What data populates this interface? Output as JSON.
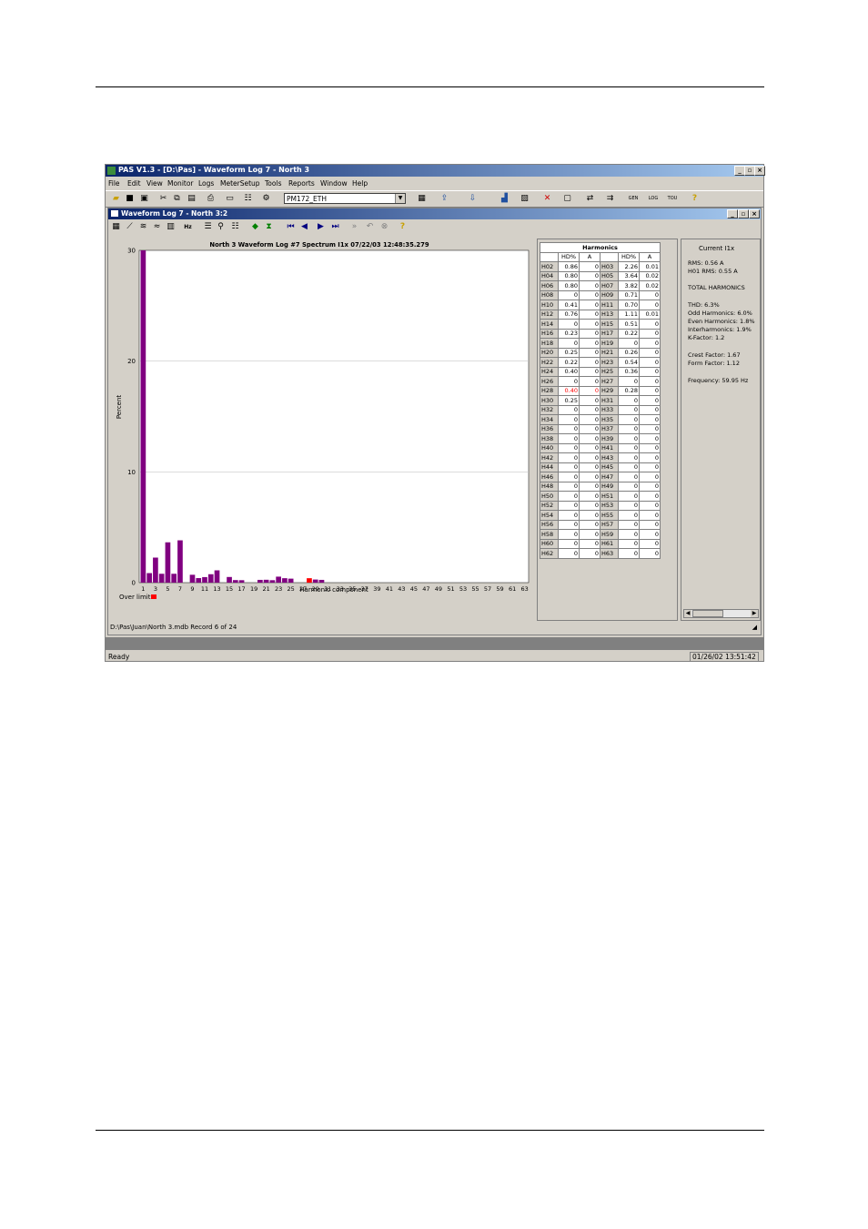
{
  "app": {
    "title": "PAS V1.3 - [D:\\Pas] - Waveform Log 7 - North 3",
    "menu": [
      "File",
      "Edit",
      "View",
      "Monitor",
      "Logs",
      "MeterSetup",
      "Tools",
      "Reports",
      "Window",
      "Help"
    ],
    "device_combo": "PM172_ETH",
    "status_left": "Ready",
    "status_right": "01/26/02 13:51:42",
    "toolbar_icons": [
      "open-icon",
      "save-icon",
      "save-all-icon",
      "cut-icon",
      "copy-icon",
      "paste-icon",
      "print-icon",
      "preview-icon",
      "properties-icon",
      "connect-icon",
      "table-icon",
      "upload-icon",
      "download-icon",
      "chart-icon",
      "image-icon",
      "delete-icon",
      "stop-icon",
      "transfer-icon",
      "transfer2-icon",
      "gen-icon",
      "log-icon",
      "tou-icon",
      "help-icon"
    ],
    "toolbar_labels": {
      "gen": "GEN",
      "log": "LOG",
      "tou": "TOU"
    }
  },
  "child": {
    "title": "Waveform Log 7 - North 3:2",
    "footer": "D:\\Pas\\Juan\\North 3.mdb  Record 6 of 24"
  },
  "chart_data": {
    "type": "bar",
    "title": "North 3  Waveform Log #7  Spectrum I1x  07/22/03  12:48:35.279",
    "xlabel": "Harmonic component",
    "ylabel": "Percent",
    "ylim": [
      0,
      30
    ],
    "yticks": [
      0,
      10,
      20,
      30
    ],
    "xtick_labels": [
      "1",
      "3",
      "5",
      "7",
      "9",
      "11",
      "13",
      "15",
      "17",
      "19",
      "21",
      "23",
      "25",
      "27",
      "29",
      "31",
      "33",
      "35",
      "37",
      "39",
      "41",
      "43",
      "45",
      "47",
      "49",
      "51",
      "53",
      "55",
      "57",
      "59",
      "61",
      "63"
    ],
    "categories": [
      1,
      2,
      3,
      4,
      5,
      6,
      7,
      8,
      9,
      10,
      11,
      12,
      13,
      14,
      15,
      16,
      17,
      18,
      19,
      20,
      21,
      22,
      23,
      24,
      25,
      26,
      27,
      28,
      29,
      30,
      31,
      32,
      33,
      34,
      35,
      36,
      37,
      38,
      39,
      40,
      41,
      42,
      43,
      44,
      45,
      46,
      47,
      48,
      49,
      50,
      51,
      52,
      53,
      54,
      55,
      56,
      57,
      58,
      59,
      60,
      61,
      62,
      63
    ],
    "values": [
      30,
      0.86,
      2.26,
      0.8,
      3.64,
      0.8,
      3.82,
      0,
      0.71,
      0.41,
      0.5,
      0.76,
      1.11,
      0,
      0.51,
      0.23,
      0.22,
      0,
      0,
      0.25,
      0.26,
      0.22,
      0.54,
      0.4,
      0.36,
      0,
      0,
      0.4,
      0.28,
      0.25,
      0,
      0,
      0,
      0,
      0,
      0,
      0,
      0,
      0,
      0,
      0,
      0,
      0,
      0,
      0,
      0,
      0,
      0,
      0,
      0,
      0,
      0,
      0,
      0,
      0,
      0,
      0,
      0,
      0,
      0,
      0,
      0,
      0
    ],
    "over_limit": [
      28
    ],
    "legend": "Over limit",
    "bar_color": "#800080",
    "over_color": "#ff0000"
  },
  "table": {
    "caption": "Harmonics",
    "headers": [
      "",
      "HD%",
      "A",
      "",
      "HD%",
      "A"
    ],
    "rows": [
      [
        "H02",
        "0.86",
        "0",
        "H03",
        "2.26",
        "0.01"
      ],
      [
        "H04",
        "0.80",
        "0",
        "H05",
        "3.64",
        "0.02"
      ],
      [
        "H06",
        "0.80",
        "0",
        "H07",
        "3.82",
        "0.02"
      ],
      [
        "H08",
        "0",
        "0",
        "H09",
        "0.71",
        "0"
      ],
      [
        "H10",
        "0.41",
        "0",
        "H11",
        "0.70",
        "0"
      ],
      [
        "H12",
        "0.76",
        "0",
        "H13",
        "1.11",
        "0.01"
      ],
      [
        "H14",
        "0",
        "0",
        "H15",
        "0.51",
        "0"
      ],
      [
        "H16",
        "0.23",
        "0",
        "H17",
        "0.22",
        "0"
      ],
      [
        "H18",
        "0",
        "0",
        "H19",
        "0",
        "0"
      ],
      [
        "H20",
        "0.25",
        "0",
        "H21",
        "0.26",
        "0"
      ],
      [
        "H22",
        "0.22",
        "0",
        "H23",
        "0.54",
        "0"
      ],
      [
        "H24",
        "0.40",
        "0",
        "H25",
        "0.36",
        "0"
      ],
      [
        "H26",
        "0",
        "0",
        "H27",
        "0",
        "0"
      ],
      [
        "H28",
        "0.40",
        "0",
        "H29",
        "0.28",
        "0"
      ],
      [
        "H30",
        "0.25",
        "0",
        "H31",
        "0",
        "0"
      ],
      [
        "H32",
        "0",
        "0",
        "H33",
        "0",
        "0"
      ],
      [
        "H34",
        "0",
        "0",
        "H35",
        "0",
        "0"
      ],
      [
        "H36",
        "0",
        "0",
        "H37",
        "0",
        "0"
      ],
      [
        "H38",
        "0",
        "0",
        "H39",
        "0",
        "0"
      ],
      [
        "H40",
        "0",
        "0",
        "H41",
        "0",
        "0"
      ],
      [
        "H42",
        "0",
        "0",
        "H43",
        "0",
        "0"
      ],
      [
        "H44",
        "0",
        "0",
        "H45",
        "0",
        "0"
      ],
      [
        "H46",
        "0",
        "0",
        "H47",
        "0",
        "0"
      ],
      [
        "H48",
        "0",
        "0",
        "H49",
        "0",
        "0"
      ],
      [
        "H50",
        "0",
        "0",
        "H51",
        "0",
        "0"
      ],
      [
        "H52",
        "0",
        "0",
        "H53",
        "0",
        "0"
      ],
      [
        "H54",
        "0",
        "0",
        "H55",
        "0",
        "0"
      ],
      [
        "H56",
        "0",
        "0",
        "H57",
        "0",
        "0"
      ],
      [
        "H58",
        "0",
        "0",
        "H59",
        "0",
        "0"
      ],
      [
        "H60",
        "0",
        "0",
        "H61",
        "0",
        "0"
      ],
      [
        "H62",
        "0",
        "0",
        "H63",
        "0",
        "0"
      ]
    ],
    "highlight_row": "H28",
    "highlight_color": "#ff0000"
  },
  "info": {
    "heading": "Current I1x",
    "rms": "RMS: 0.56 A",
    "h01_rms": "H01 RMS: 0.55 A",
    "total_heading": "TOTAL HARMONICS",
    "thd": "THD: 6.3%",
    "odd": "Odd Harmonics: 6.0%",
    "even": "Even Harmonics: 1.8%",
    "inter": "Interharmonics: 1.9%",
    "kfactor": "K-Factor: 1.2",
    "crest": "Crest Factor: 1.67",
    "form": "Form Factor: 1.12",
    "freq": "Frequency: 59.95 Hz"
  }
}
